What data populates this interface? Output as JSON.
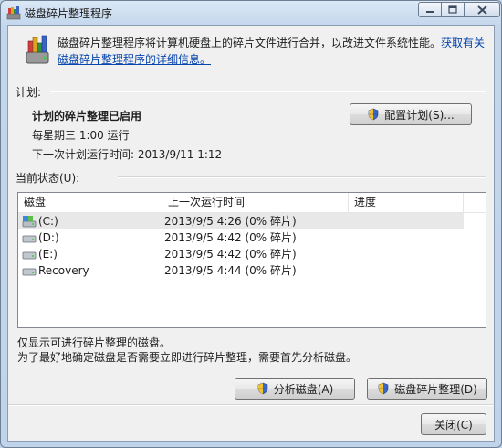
{
  "window": {
    "title": "磁盘碎片整理程序",
    "min_icon": "minimize-icon",
    "max_icon": "maximize-icon",
    "close_icon": "close-icon"
  },
  "intro": {
    "text": "磁盘碎片整理程序将计算机硬盘上的碎片文件进行合并，以改进文件系统性能。",
    "link": "获取有关磁盘碎片整理程序的详细信息。"
  },
  "schedule": {
    "label": "计划:",
    "status": "计划的碎片整理已启用",
    "frequency": "每星期三  1:00 运行",
    "next_run": "下一次计划运行时间: 2013/9/11 1:12",
    "configure_button": "配置计划(S)..."
  },
  "current_status": {
    "label": "当前状态(U):",
    "columns": [
      "磁盘",
      "上一次运行时间",
      "进度"
    ],
    "rows": [
      {
        "disk": "(C:)",
        "last_run": "2013/9/5 4:26 (0% 碎片)",
        "progress": "",
        "icon": "system-drive-icon"
      },
      {
        "disk": "(D:)",
        "last_run": "2013/9/5 4:42 (0% 碎片)",
        "progress": "",
        "icon": "drive-icon"
      },
      {
        "disk": "(E:)",
        "last_run": "2013/9/5 4:42 (0% 碎片)",
        "progress": "",
        "icon": "drive-icon"
      },
      {
        "disk": "Recovery",
        "last_run": "2013/9/5 4:44 (0% 碎片)",
        "progress": "",
        "icon": "drive-icon"
      }
    ]
  },
  "notes": {
    "line1": "仅显示可进行碎片整理的磁盘。",
    "line2": "为了最好地确定磁盘是否需要立即进行碎片整理，需要首先分析磁盘。"
  },
  "buttons": {
    "analyze": "分析磁盘(A)",
    "defragment": "磁盘碎片整理(D)",
    "close": "关闭(C)"
  },
  "colors": {
    "link": "#0645ad",
    "title_bar": "#c3d6ec",
    "client_bg": "#f0f0f0"
  }
}
